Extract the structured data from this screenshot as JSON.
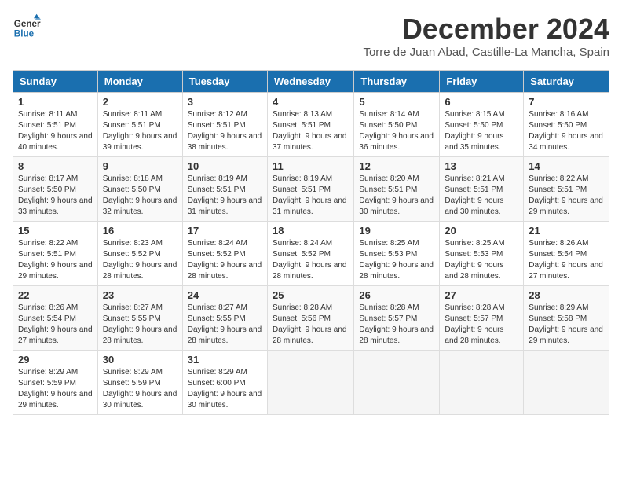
{
  "header": {
    "logo_general": "General",
    "logo_blue": "Blue",
    "month_title": "December 2024",
    "location": "Torre de Juan Abad, Castille-La Mancha, Spain"
  },
  "columns": [
    "Sunday",
    "Monday",
    "Tuesday",
    "Wednesday",
    "Thursday",
    "Friday",
    "Saturday"
  ],
  "weeks": [
    [
      {
        "day": "1",
        "rise": "Sunrise: 8:11 AM",
        "set": "Sunset: 5:51 PM",
        "daylight": "Daylight: 9 hours and 40 minutes."
      },
      {
        "day": "2",
        "rise": "Sunrise: 8:11 AM",
        "set": "Sunset: 5:51 PM",
        "daylight": "Daylight: 9 hours and 39 minutes."
      },
      {
        "day": "3",
        "rise": "Sunrise: 8:12 AM",
        "set": "Sunset: 5:51 PM",
        "daylight": "Daylight: 9 hours and 38 minutes."
      },
      {
        "day": "4",
        "rise": "Sunrise: 8:13 AM",
        "set": "Sunset: 5:51 PM",
        "daylight": "Daylight: 9 hours and 37 minutes."
      },
      {
        "day": "5",
        "rise": "Sunrise: 8:14 AM",
        "set": "Sunset: 5:50 PM",
        "daylight": "Daylight: 9 hours and 36 minutes."
      },
      {
        "day": "6",
        "rise": "Sunrise: 8:15 AM",
        "set": "Sunset: 5:50 PM",
        "daylight": "Daylight: 9 hours and 35 minutes."
      },
      {
        "day": "7",
        "rise": "Sunrise: 8:16 AM",
        "set": "Sunset: 5:50 PM",
        "daylight": "Daylight: 9 hours and 34 minutes."
      }
    ],
    [
      {
        "day": "8",
        "rise": "Sunrise: 8:17 AM",
        "set": "Sunset: 5:50 PM",
        "daylight": "Daylight: 9 hours and 33 minutes."
      },
      {
        "day": "9",
        "rise": "Sunrise: 8:18 AM",
        "set": "Sunset: 5:50 PM",
        "daylight": "Daylight: 9 hours and 32 minutes."
      },
      {
        "day": "10",
        "rise": "Sunrise: 8:19 AM",
        "set": "Sunset: 5:51 PM",
        "daylight": "Daylight: 9 hours and 31 minutes."
      },
      {
        "day": "11",
        "rise": "Sunrise: 8:19 AM",
        "set": "Sunset: 5:51 PM",
        "daylight": "Daylight: 9 hours and 31 minutes."
      },
      {
        "day": "12",
        "rise": "Sunrise: 8:20 AM",
        "set": "Sunset: 5:51 PM",
        "daylight": "Daylight: 9 hours and 30 minutes."
      },
      {
        "day": "13",
        "rise": "Sunrise: 8:21 AM",
        "set": "Sunset: 5:51 PM",
        "daylight": "Daylight: 9 hours and 30 minutes."
      },
      {
        "day": "14",
        "rise": "Sunrise: 8:22 AM",
        "set": "Sunset: 5:51 PM",
        "daylight": "Daylight: 9 hours and 29 minutes."
      }
    ],
    [
      {
        "day": "15",
        "rise": "Sunrise: 8:22 AM",
        "set": "Sunset: 5:51 PM",
        "daylight": "Daylight: 9 hours and 29 minutes."
      },
      {
        "day": "16",
        "rise": "Sunrise: 8:23 AM",
        "set": "Sunset: 5:52 PM",
        "daylight": "Daylight: 9 hours and 28 minutes."
      },
      {
        "day": "17",
        "rise": "Sunrise: 8:24 AM",
        "set": "Sunset: 5:52 PM",
        "daylight": "Daylight: 9 hours and 28 minutes."
      },
      {
        "day": "18",
        "rise": "Sunrise: 8:24 AM",
        "set": "Sunset: 5:52 PM",
        "daylight": "Daylight: 9 hours and 28 minutes."
      },
      {
        "day": "19",
        "rise": "Sunrise: 8:25 AM",
        "set": "Sunset: 5:53 PM",
        "daylight": "Daylight: 9 hours and 28 minutes."
      },
      {
        "day": "20",
        "rise": "Sunrise: 8:25 AM",
        "set": "Sunset: 5:53 PM",
        "daylight": "Daylight: 9 hours and 28 minutes."
      },
      {
        "day": "21",
        "rise": "Sunrise: 8:26 AM",
        "set": "Sunset: 5:54 PM",
        "daylight": "Daylight: 9 hours and 27 minutes."
      }
    ],
    [
      {
        "day": "22",
        "rise": "Sunrise: 8:26 AM",
        "set": "Sunset: 5:54 PM",
        "daylight": "Daylight: 9 hours and 27 minutes."
      },
      {
        "day": "23",
        "rise": "Sunrise: 8:27 AM",
        "set": "Sunset: 5:55 PM",
        "daylight": "Daylight: 9 hours and 28 minutes."
      },
      {
        "day": "24",
        "rise": "Sunrise: 8:27 AM",
        "set": "Sunset: 5:55 PM",
        "daylight": "Daylight: 9 hours and 28 minutes."
      },
      {
        "day": "25",
        "rise": "Sunrise: 8:28 AM",
        "set": "Sunset: 5:56 PM",
        "daylight": "Daylight: 9 hours and 28 minutes."
      },
      {
        "day": "26",
        "rise": "Sunrise: 8:28 AM",
        "set": "Sunset: 5:57 PM",
        "daylight": "Daylight: 9 hours and 28 minutes."
      },
      {
        "day": "27",
        "rise": "Sunrise: 8:28 AM",
        "set": "Sunset: 5:57 PM",
        "daylight": "Daylight: 9 hours and 28 minutes."
      },
      {
        "day": "28",
        "rise": "Sunrise: 8:29 AM",
        "set": "Sunset: 5:58 PM",
        "daylight": "Daylight: 9 hours and 29 minutes."
      }
    ],
    [
      {
        "day": "29",
        "rise": "Sunrise: 8:29 AM",
        "set": "Sunset: 5:59 PM",
        "daylight": "Daylight: 9 hours and 29 minutes."
      },
      {
        "day": "30",
        "rise": "Sunrise: 8:29 AM",
        "set": "Sunset: 5:59 PM",
        "daylight": "Daylight: 9 hours and 30 minutes."
      },
      {
        "day": "31",
        "rise": "Sunrise: 8:29 AM",
        "set": "Sunset: 6:00 PM",
        "daylight": "Daylight: 9 hours and 30 minutes."
      },
      null,
      null,
      null,
      null
    ]
  ]
}
